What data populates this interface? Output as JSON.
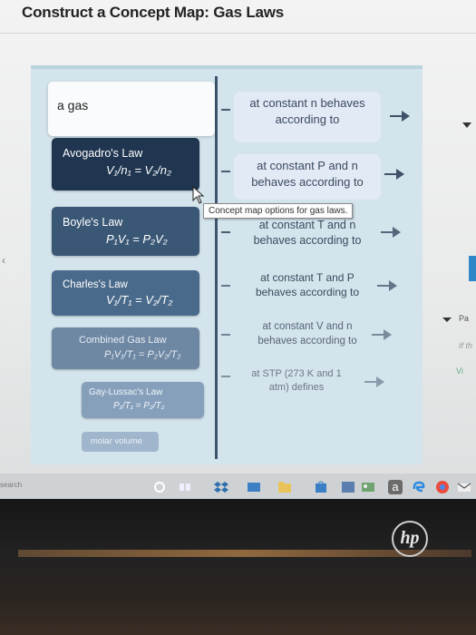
{
  "page": {
    "title": "Construct a Concept Map: Gas Laws"
  },
  "options": [
    {
      "name": "a gas",
      "eq": ""
    },
    {
      "name": "Avogadro's Law",
      "eq": "V₁/n₁ = V₂/n₂"
    },
    {
      "name": "Boyle's Law",
      "eq": "P₁V₁ = P₂V₂"
    },
    {
      "name": "Charles's Law",
      "eq": "V₁/T₁ = V₂/T₂"
    },
    {
      "name": "Combined Gas Law",
      "eq": "P₁V₁/T₁ = P₂V₂/T₂"
    },
    {
      "name": "Gay-Lussac's Law",
      "eq": "P₁/T₁ = P₂/T₂"
    },
    {
      "name": "molar volume",
      "eq": ""
    }
  ],
  "statements": [
    {
      "line1": "at constant n behaves",
      "line2": "according to"
    },
    {
      "line1": "at constant P and n",
      "line2": "behaves according to"
    },
    {
      "line1": "at constant T and n",
      "line2": "behaves according to"
    },
    {
      "line1": "at constant T and P",
      "line2": "behaves according to"
    },
    {
      "line1": "at constant V and n",
      "line2": "behaves according to"
    },
    {
      "line1": "at STP (273 K and 1",
      "line2": "atm) defines"
    }
  ],
  "tooltip": "Concept map options for gas laws.",
  "right_panel": {
    "text1": "Pa",
    "text2": "If th",
    "text3": "Vi"
  },
  "taskbar": {
    "search": "search",
    "icon_letter": "a"
  },
  "brand": {
    "logo": "hp"
  },
  "colors": {
    "accent": "#2d4a66",
    "panel": "#d4e4ec"
  }
}
